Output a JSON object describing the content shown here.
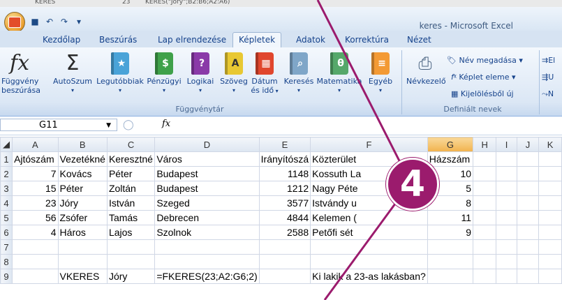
{
  "top_strip": {
    "a": "KERES",
    "b": "23",
    "c": "KERES(\"Jóry\";B2:B6;A2:A6)"
  },
  "title_bar": {
    "title": "keres - Microsoft Excel"
  },
  "tabs": [
    "Kezdőlap",
    "Beszúrás",
    "Lap elrendezése",
    "Képletek",
    "Adatok",
    "Korrektúra",
    "Nézet"
  ],
  "active_tab": "Képletek",
  "ribbon": {
    "insert_function": [
      "Függvény",
      "beszúrása"
    ],
    "autosum": "AutoSzum",
    "recent": "Legutóbbiak",
    "financial": "Pénzügyi",
    "logical": "Logikai",
    "text": "Szöveg",
    "datetime": [
      "Dátum",
      "és idő"
    ],
    "lookup": "Keresés",
    "math": "Matematika",
    "more": "Egyéb",
    "library_group": "Függvénytár",
    "name_manager": "Névkezelő",
    "define_name": "Név megadása",
    "use_in_formula": "Képlet eleme",
    "create_from_selection": "Kijelölésből új",
    "names_group": "Definiált nevek",
    "audit_1": "El",
    "audit_2": "U",
    "audit_3": "N"
  },
  "formula_bar": {
    "name_box": "G11",
    "fx": "fx",
    "formula": ""
  },
  "sheet": {
    "columns": [
      "A",
      "B",
      "C",
      "D",
      "E",
      "F",
      "G",
      "H",
      "I",
      "J",
      "K"
    ],
    "rows": [
      {
        "n": "1",
        "A": "Ajtószám",
        "B": "Vezetékné",
        "C": "Keresztné",
        "D": "Város",
        "E": "Irányítószá",
        "F": "Közterület",
        "G": "Házszám",
        "H": ""
      },
      {
        "n": "2",
        "A": "7",
        "B": "Kovács",
        "C": "Péter",
        "D": "Budapest",
        "E": "1148",
        "F": "Kossuth La",
        "G": "10",
        "H": ""
      },
      {
        "n": "3",
        "A": "15",
        "B": "Péter",
        "C": "Zoltán",
        "D": "Budapest",
        "E": "1212",
        "F": "Nagy Péte",
        "G": "5",
        "H": ""
      },
      {
        "n": "4",
        "A": "23",
        "B": "Jóry",
        "C": "István",
        "D": "Szeged",
        "E": "3577",
        "F": "Istvándy u",
        "G": "8",
        "H": ""
      },
      {
        "n": "5",
        "A": "56",
        "B": "Zsófer",
        "C": "Tamás",
        "D": "Debrecen",
        "E": "4844",
        "F": "Kelemen (",
        "G": "11",
        "H": ""
      },
      {
        "n": "6",
        "A": "4",
        "B": "Háros",
        "C": "Lajos",
        "D": "Szolnok",
        "E": "2588",
        "F": "Petőfi sét",
        "G": "9",
        "H": ""
      },
      {
        "n": "7",
        "A": "",
        "B": "",
        "C": "",
        "D": "",
        "E": "",
        "F": "",
        "G": "",
        "H": ""
      },
      {
        "n": "8",
        "A": "",
        "B": "",
        "C": "",
        "D": "",
        "E": "",
        "F": "",
        "G": "",
        "H": ""
      },
      {
        "n": "9",
        "A": "",
        "B": "VKERES",
        "C": "Jóry",
        "D": "=FKERES(23;A2:G6;2)",
        "E": "",
        "F": "Ki lakik a 23-as lakásban?",
        "G": "",
        "H": ""
      }
    ]
  },
  "badge": "4",
  "colors": {
    "badge": "#9b1b6d",
    "ribbon": "#dbe7f5",
    "selected_col": "#f1b24d"
  }
}
